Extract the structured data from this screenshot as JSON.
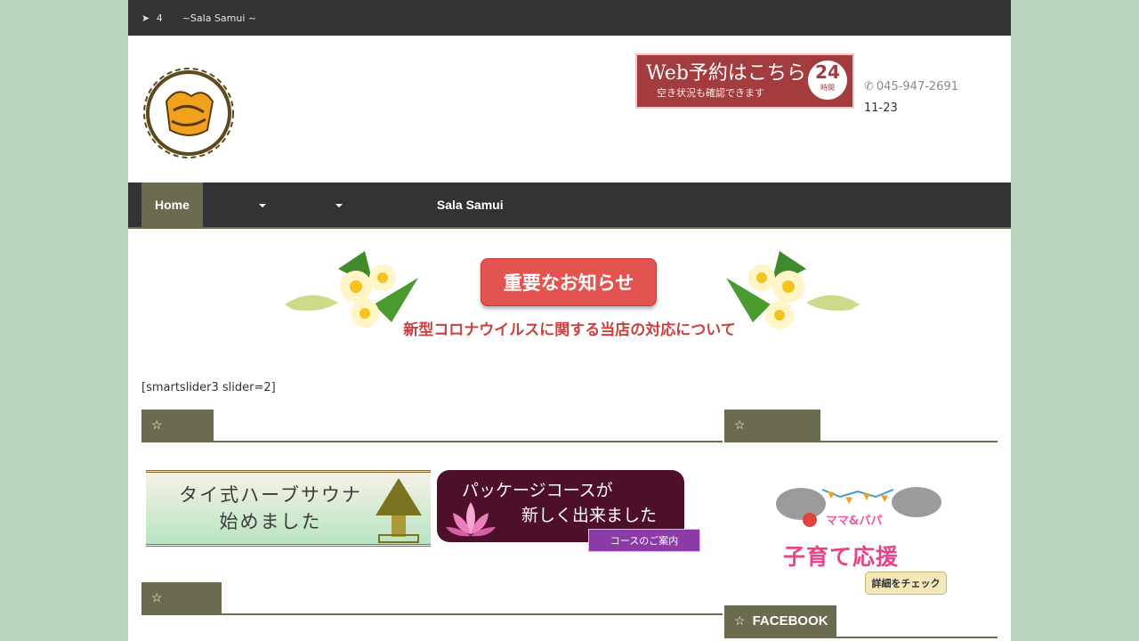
{
  "topbar": {
    "text": "⁪⁪⁪⁪⁪ ⁪⁪⁪⁪⁪⁪⁪4⁪　⁪⁪⁪⁪⁪⁪⁪　~Sala Samui ⁪⁪⁪⁪⁪~",
    "icon": "location-arrow-icon"
  },
  "header": {
    "web_banner_line1": "Web予約はこちら",
    "web_banner_line2": "空き状況も確認できます",
    "web_banner_badge": "24",
    "web_banner_badge_sub": "時間",
    "contact_line1": "⁪⁪⁪⁪⁪⁪⁪",
    "phone": "045-947-2691",
    "hours": "⁪⁪⁪⁪⁪11⁪-23⁪"
  },
  "nav": {
    "items": [
      {
        "label": "Home"
      },
      {
        "label": ""
      },
      {
        "label": ""
      },
      {
        "label": "Sala Samui"
      }
    ]
  },
  "notice": {
    "button_label": "重要なお知らせ",
    "subtitle": "新型コロナウイルスに関する当店の対応について"
  },
  "main": {
    "shortcode": "[smartslider3 slider=2]",
    "widget1_title": "",
    "widget2_title": "",
    "sauna_line1": "タイ式ハーブサウナ",
    "sauna_line2": "始めました",
    "package_line1": "パッケージコースが",
    "package_line2": "新しく出来ました",
    "package_ribbon": "コースのご案内"
  },
  "sidebar": {
    "widget1_title": "",
    "kids_title1": "ママ&パパ",
    "kids_title2": "子育て応援",
    "kids_button": "詳細をチェック",
    "facebook_title": "FACEBOOK"
  },
  "colors": {
    "background": "#b9d5bf",
    "dark_bar": "#333333",
    "accent_olive": "#6b6b4f",
    "notice_red": "#e35450"
  }
}
